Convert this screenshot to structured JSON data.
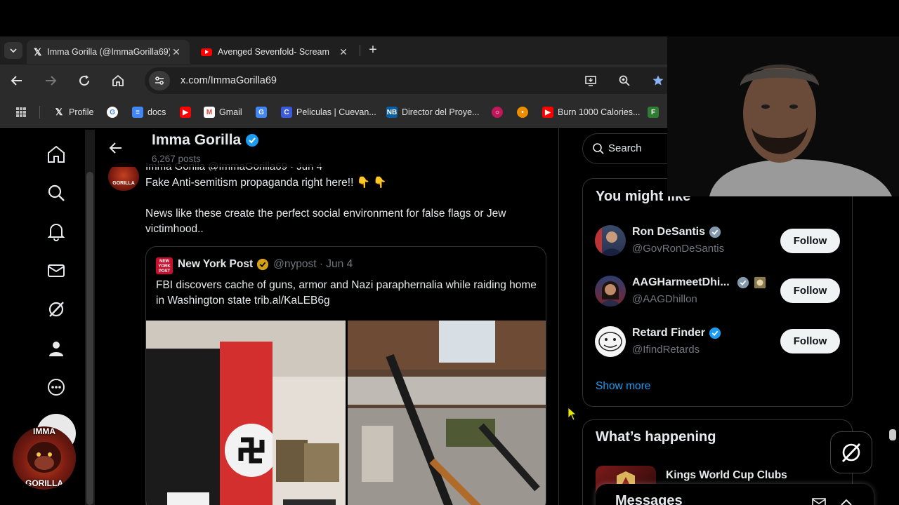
{
  "browser": {
    "tabs": [
      {
        "title": "Imma Gorilla (@ImmaGorilla69) / X",
        "active": true
      },
      {
        "title": "Avenged Sevenfold- Scream",
        "active": false
      }
    ],
    "url": "x.com/ImmaGorilla69",
    "bookmarks": [
      "Profile",
      "docs",
      "Gmail",
      "Peliculas | Cuevan...",
      "Director del Proye...",
      "Burn 1000 Calories..."
    ]
  },
  "profile": {
    "name": "Imma Gorilla",
    "posts_count": "6,267 posts"
  },
  "post": {
    "header_partial": "Imma Gorilla  @ImmaGorilla69 · Jun 4",
    "line1": "Fake Anti-semitism propaganda right here!! 👇 👇",
    "line2": "News like these create the perfect social environment for false flags or Jew victimhood..",
    "avatar_label": "GORILLA"
  },
  "quote": {
    "name": "New York Post",
    "handle_date": "@nypost · Jun 4",
    "text": "FBI discovers cache of guns, armor and Nazi paraphernalia while raiding home in Washington state trib.al/KaLEB6g",
    "logo_text": "NEW YORK POST"
  },
  "sidebar": {
    "search_placeholder": "Search",
    "you_might_like_title": "You might like",
    "suggestions": [
      {
        "name": "Ron DeSantis",
        "handle": "@GovRonDeSantis",
        "follow": "Follow"
      },
      {
        "name": "AAGHarmeetDhi...",
        "handle": "@AAGDhillon",
        "follow": "Follow"
      },
      {
        "name": "Retard Finder",
        "handle": "@IfindRetards",
        "follow": "Follow"
      }
    ],
    "show_more": "Show more",
    "whats_happening_title": "What’s happening",
    "trend_name": "Kings World Cup Clubs",
    "messages_label": "Messages"
  },
  "avatar": {
    "label_top": "IMMA",
    "label_bottom": "GORILLA"
  },
  "colors": {
    "accent": "#1d9bf0",
    "verified": "#1d9bf0",
    "gold": "#d4a017",
    "background": "#000000"
  }
}
